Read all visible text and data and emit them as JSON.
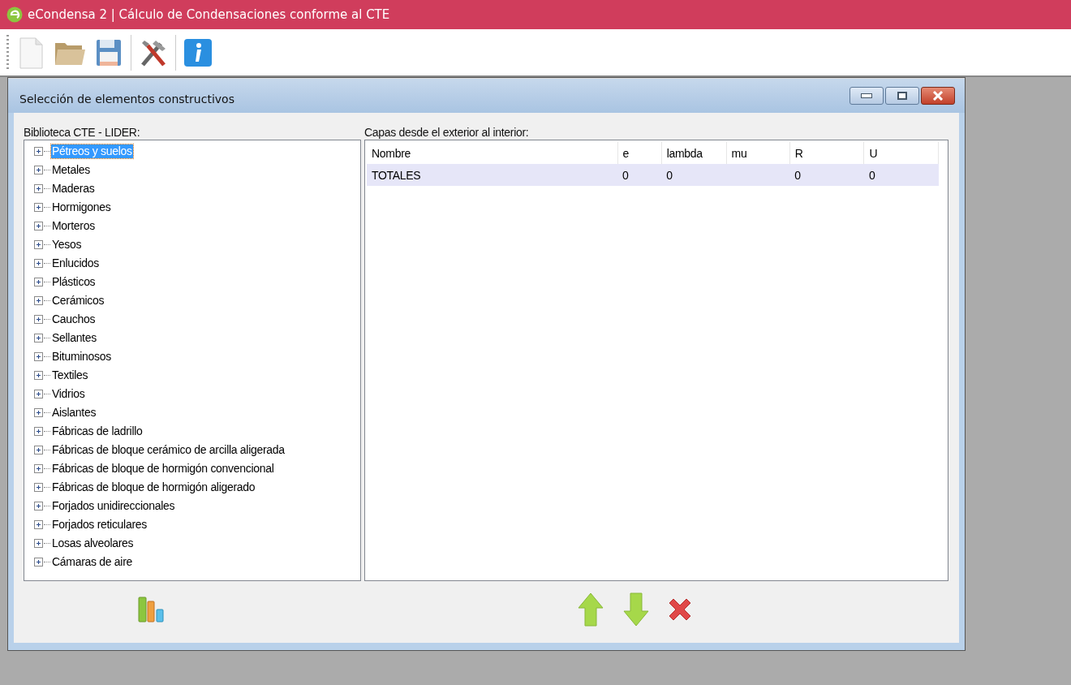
{
  "window": {
    "title": "eCondensa 2 | Cálculo de Condensaciones conforme al CTE"
  },
  "dialog": {
    "title": "Selección de elementos constructivos",
    "library": {
      "label": "Biblioteca CTE - LIDER:",
      "items": [
        {
          "label": "Pétreos y suelos",
          "expanded": false,
          "selected": true
        },
        {
          "label": "Metales",
          "expanded": false,
          "selected": false
        },
        {
          "label": "Maderas",
          "expanded": false,
          "selected": false
        },
        {
          "label": "Hormigones",
          "expanded": false,
          "selected": false
        },
        {
          "label": "Morteros",
          "expanded": false,
          "selected": false
        },
        {
          "label": "Yesos",
          "expanded": false,
          "selected": false
        },
        {
          "label": "Enlucidos",
          "expanded": false,
          "selected": false
        },
        {
          "label": "Plásticos",
          "expanded": false,
          "selected": false
        },
        {
          "label": "Cerámicos",
          "expanded": false,
          "selected": false
        },
        {
          "label": "Cauchos",
          "expanded": false,
          "selected": false
        },
        {
          "label": "Sellantes",
          "expanded": false,
          "selected": false
        },
        {
          "label": "Bituminosos",
          "expanded": false,
          "selected": false
        },
        {
          "label": "Textiles",
          "expanded": false,
          "selected": false
        },
        {
          "label": "Vidrios",
          "expanded": false,
          "selected": false
        },
        {
          "label": "Aislantes",
          "expanded": false,
          "selected": false
        },
        {
          "label": "Fábricas de ladrillo",
          "expanded": false,
          "selected": false
        },
        {
          "label": "Fábricas de bloque cerámico de arcilla aligerada",
          "expanded": false,
          "selected": false
        },
        {
          "label": "Fábricas de bloque de hormigón convencional",
          "expanded": false,
          "selected": false
        },
        {
          "label": "Fábricas de bloque de hormigón aligerado",
          "expanded": false,
          "selected": false
        },
        {
          "label": "Forjados unidireccionales",
          "expanded": false,
          "selected": false
        },
        {
          "label": "Forjados reticulares",
          "expanded": false,
          "selected": false
        },
        {
          "label": "Losas alveolares",
          "expanded": false,
          "selected": false
        },
        {
          "label": "Cámaras de aire",
          "expanded": false,
          "selected": false
        }
      ]
    },
    "layers": {
      "label": "Capas desde el exterior al interior:",
      "columns": [
        "Nombre",
        "e",
        "lambda",
        "mu",
        "R",
        "U"
      ],
      "rows": [
        [
          "TOTALES",
          "0",
          "0",
          "",
          "0",
          "0"
        ]
      ]
    }
  }
}
